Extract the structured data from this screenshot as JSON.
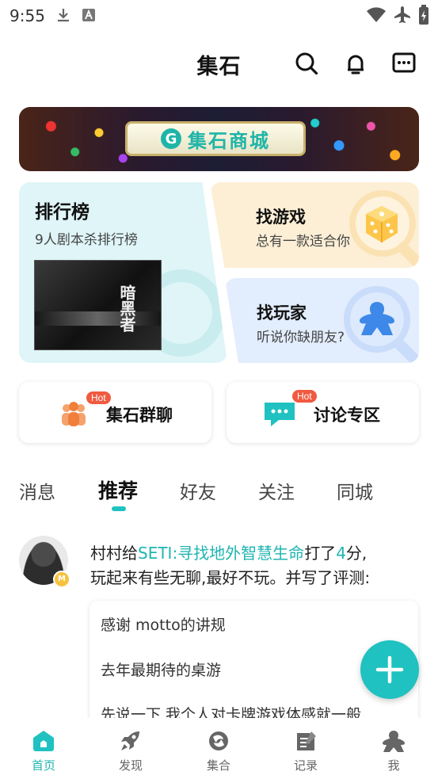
{
  "status_bar": {
    "time": "9:55"
  },
  "header": {
    "title": "集石"
  },
  "banner": {
    "label": "集石商城"
  },
  "cards": {
    "ranking": {
      "title": "排行榜",
      "subtitle": "9人剧本杀排行榜",
      "poster_title": "暗黑者"
    },
    "find_game": {
      "title": "找游戏",
      "subtitle": "总有一款适合你"
    },
    "find_player": {
      "title": "找玩家",
      "subtitle": "听说你缺朋友?"
    }
  },
  "pills": [
    {
      "label": "集石群聊",
      "badge": "Hot"
    },
    {
      "label": "讨论专区",
      "badge": "Hot"
    }
  ],
  "tabs": [
    "消息",
    "推荐",
    "好友",
    "关注",
    "同城"
  ],
  "active_tab": "推荐",
  "feed": {
    "user": "村村",
    "verb_give": "给",
    "game": "SETI:寻找地外智慧生命",
    "verb_rate": "打了",
    "score": "4",
    "score_unit": "分,",
    "text_line2": "玩起来有些无聊,最好不玩。并写了评测:",
    "badge": "M",
    "review_lines": [
      "感谢 motto的讲规",
      "去年最期待的桌游",
      "先说一下 我个人对卡牌游戏体感就一般"
    ]
  },
  "bottom_nav": [
    {
      "label": "首页",
      "icon": "home-icon",
      "active": true
    },
    {
      "label": "发现",
      "icon": "rocket-icon",
      "active": false
    },
    {
      "label": "集合",
      "icon": "collection-icon",
      "active": false
    },
    {
      "label": "记录",
      "icon": "record-icon",
      "active": false
    },
    {
      "label": "我",
      "icon": "meeple-icon",
      "active": false
    }
  ],
  "colors": {
    "accent": "#1fc2c0",
    "hot": "#f05a40",
    "game_card": "#fdefd6",
    "player_card": "#e2edfd",
    "rank_card": "#dff5f7"
  }
}
